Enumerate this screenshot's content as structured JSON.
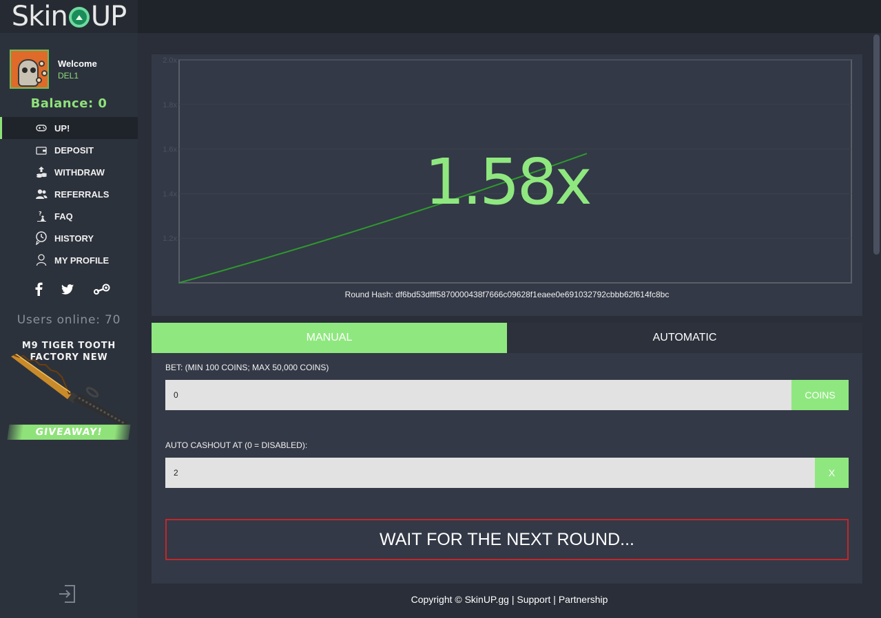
{
  "brand": {
    "logo_left": "Skin",
    "logo_right": "UP"
  },
  "user": {
    "welcome": "Welcome",
    "name": "DEL1"
  },
  "balance": {
    "label": "Balance: 0"
  },
  "nav": [
    {
      "label": "UP!",
      "icon": "gamepad-icon"
    },
    {
      "label": "DEPOSIT",
      "icon": "wallet-icon"
    },
    {
      "label": "WITHDRAW",
      "icon": "coins-icon"
    },
    {
      "label": "REFERRALS",
      "icon": "users-icon"
    },
    {
      "label": "FAQ",
      "icon": "question-icon"
    },
    {
      "label": "HISTORY",
      "icon": "clock-icon"
    },
    {
      "label": "MY PROFILE",
      "icon": "user-icon"
    }
  ],
  "socials": [
    "facebook-icon",
    "twitter-icon",
    "steam-icon"
  ],
  "online": {
    "label": "Users online: 70"
  },
  "promo": {
    "title_line1": "M9 TIGER TOOTH",
    "title_line2": "FACTORY NEW",
    "badge": "GIVEAWAY!"
  },
  "game": {
    "multiplier": "1.58x",
    "round_hash_label": "Round Hash: df6bd53dfff5870000438f7666c09628f1eaee0e691032792cbbb62f614fc8bc"
  },
  "chart_data": {
    "type": "line",
    "y_ticks": [
      "2.0x",
      "1.8x",
      "1.6x",
      "1.4x",
      "1.2x"
    ],
    "ylim": [
      1.0,
      2.0
    ],
    "series": [
      {
        "values": [
          1.0,
          1.58
        ]
      }
    ],
    "line_color": "#2e9a2e",
    "grid": true
  },
  "bet": {
    "tabs": {
      "manual": "MANUAL",
      "automatic": "AUTOMATIC"
    },
    "bet_label": "BET: (MIN 100 COINS; MAX 50,000 COINS)",
    "bet_value": "0",
    "bet_addon": "COINS",
    "cashout_label": "AUTO CASHOUT AT (0 = DISABLED):",
    "cashout_value": "2",
    "cashout_addon": "X",
    "action_button": "WAIT FOR THE NEXT ROUND..."
  },
  "footer": {
    "copyright": "Copyright © SkinUP.gg",
    "sep": "|",
    "support": "Support",
    "partnership": "Partnership"
  },
  "colors": {
    "accent": "#8fe87f",
    "danger": "#c4262a",
    "panel": "#333946",
    "sidebar": "#2c323c"
  }
}
